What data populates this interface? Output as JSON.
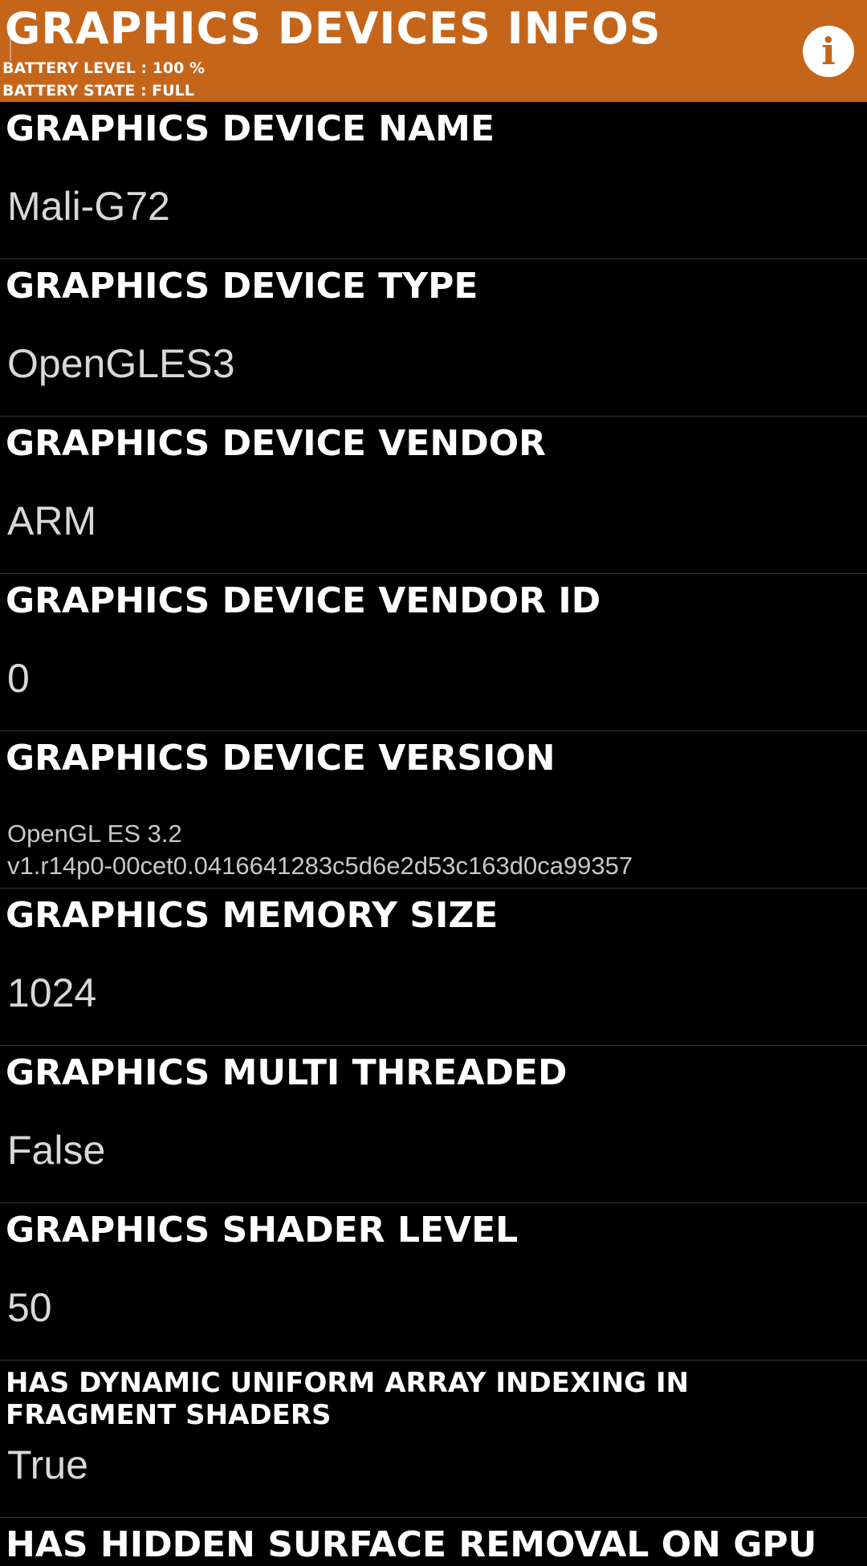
{
  "header": {
    "title": "GRAPHICS DEVICES INFOS",
    "battery_level": "BATTERY LEVEL : 100 %",
    "battery_state": "BATTERY STATE : FULL",
    "info_icon": "info-icon",
    "info_glyph": "i",
    "background_color": "#C5651A"
  },
  "rows": [
    {
      "label": "GRAPHICS DEVICE NAME",
      "value": "Mali-G72"
    },
    {
      "label": "GRAPHICS DEVICE TYPE",
      "value": "OpenGLES3"
    },
    {
      "label": "GRAPHICS DEVICE VENDOR",
      "value": "ARM"
    },
    {
      "label": "GRAPHICS DEVICE VENDOR ID",
      "value": "0"
    },
    {
      "label": "GRAPHICS DEVICE VERSION",
      "value": "OpenGL ES 3.2\nv1.r14p0-00cet0.0416641283c5d6e2d53c163d0ca99357"
    },
    {
      "label": "GRAPHICS MEMORY SIZE",
      "value": "1024"
    },
    {
      "label": "GRAPHICS MULTI THREADED",
      "value": "False"
    },
    {
      "label": "GRAPHICS SHADER LEVEL",
      "value": "50"
    },
    {
      "label": "HAS DYNAMIC UNIFORM ARRAY INDEXING IN FRAGMENT SHADERS",
      "value": "True"
    },
    {
      "label": "HAS HIDDEN SURFACE REMOVAL ON GPU",
      "value": ""
    }
  ]
}
